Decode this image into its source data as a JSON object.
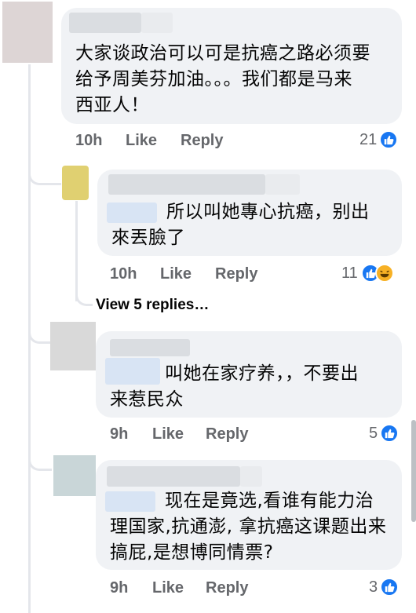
{
  "comments": [
    {
      "text_lines": [
        "大家谈政治可以可是抗癌之路必须要",
        "给予周美芬加油。。。我们都是马来",
        "西亚人！"
      ],
      "time": "10h",
      "like_label": "Like",
      "reply_label": "Reply",
      "reaction_count": "21",
      "reactions": [
        "like-icon"
      ]
    },
    {
      "text_lines": [
        "所以叫她專心抗癌，别出",
        "來丟臉了"
      ],
      "time": "10h",
      "like_label": "Like",
      "reply_label": "Reply",
      "reaction_count": "11",
      "reactions": [
        "like-icon",
        "haha-icon"
      ]
    },
    {
      "text_lines": [
        "叫她在家疗养，，不要出",
        "来惹民众"
      ],
      "time": "9h",
      "like_label": "Like",
      "reply_label": "Reply",
      "reaction_count": "5",
      "reactions": [
        "like-icon"
      ]
    },
    {
      "text_lines": [
        "现在是竟选,看谁有能力治",
        "理国家,抗通澎, 拿抗癌这课题出来",
        "搞屁,是想博同情票?"
      ],
      "time": "9h",
      "like_label": "Like",
      "reply_label": "Reply",
      "reaction_count": "3",
      "reactions": [
        "like-icon"
      ]
    }
  ],
  "view_replies": "View 5 replies…",
  "colors": {
    "bubble": "#f0f2f5",
    "like_blue": "#1877f2",
    "haha_yellow": "#f7b125",
    "meta_gray": "#65676b"
  }
}
